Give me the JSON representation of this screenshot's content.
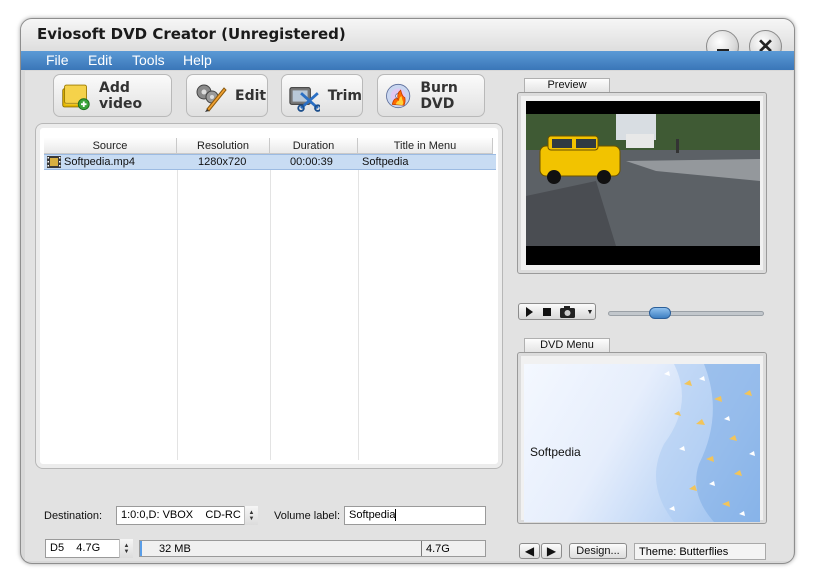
{
  "window": {
    "title": "Eviosoft DVD Creator (Unregistered)"
  },
  "menu": {
    "items": [
      "File",
      "Edit",
      "Tools",
      "Help"
    ]
  },
  "toolbar": {
    "add_video": "Add video",
    "edit": "Edit",
    "trim": "Trim",
    "burn_dvd": "Burn DVD"
  },
  "file_list": {
    "columns": [
      "Source",
      "Resolution",
      "Duration",
      "Title in Menu"
    ],
    "rows": [
      {
        "source": "Softpedia.mp4",
        "resolution": "1280x720",
        "duration": "00:00:39",
        "title": "Softpedia"
      }
    ]
  },
  "bottom": {
    "destination_label": "Destination:",
    "destination_value": "1:0:0,D: VBOX    CD-RC",
    "volume_label": "Volume label:",
    "volume_value": "Softpedia",
    "disc_type": "D5    4.7G",
    "used_size": "32 MB",
    "capacity": "4.7G",
    "usage_fraction": 0.007
  },
  "preview": {
    "tab_label": "Preview",
    "seek_fraction": 0.3
  },
  "dvd_menu": {
    "tab_label": "DVD Menu",
    "menu_title": "Softpedia",
    "design_button": "Design...",
    "theme_label": "Theme: Butterflies"
  },
  "colors": {
    "menubar": "#3a76b8",
    "selection": "#c8dcf3",
    "taxi": "#f2c300"
  }
}
